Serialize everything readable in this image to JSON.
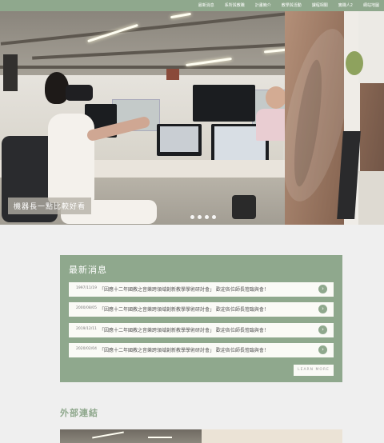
{
  "nav": {
    "items": [
      {
        "label": "最新消息"
      },
      {
        "label": "系所與教職"
      },
      {
        "label": "計畫簡介"
      },
      {
        "label": "教學與活動"
      },
      {
        "label": "課程相關"
      },
      {
        "label": "實踐人2"
      },
      {
        "label": "網站地圖"
      }
    ]
  },
  "hero": {
    "caption": "機器長一點比較好看",
    "slides_count": 4,
    "active_slide": 1
  },
  "news": {
    "title": "最新消息",
    "items": [
      {
        "date": "1997/11/19",
        "text": "「因應十二年國教之音樂跨領域創新教學學術研討會」 歡迎各位師長蒞臨與會！"
      },
      {
        "date": "2000/08/05",
        "text": "「因應十二年國教之音樂跨領域創新教學學術研討會」 歡迎各位師長蒞臨與會！"
      },
      {
        "date": "2019/12/11",
        "text": "「因應十二年國教之音樂跨領域創新教學學術研討會」 歡迎各位師長蒞臨與會！"
      },
      {
        "date": "2020/02/04",
        "text": "「因應十二年國教之音樂跨領域創新教學學術研討會」 歡迎各位師長蒞臨與會！"
      }
    ],
    "more_label": "LEARN MORE",
    "arrow_icon": "chevron-right-icon"
  },
  "links": {
    "title": "外部連結"
  },
  "colors": {
    "accent": "#8fa88d",
    "background": "#efefef",
    "row_bg": "#fafaf6"
  }
}
